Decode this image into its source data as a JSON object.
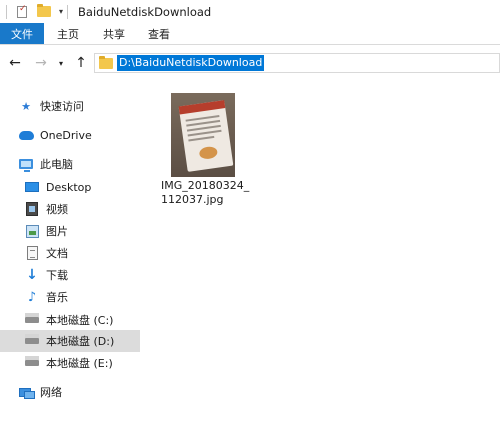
{
  "window": {
    "title": "BaiduNetdiskDownload"
  },
  "ribbon": {
    "tabs": [
      {
        "label": "文件"
      },
      {
        "label": "主页"
      },
      {
        "label": "共享"
      },
      {
        "label": "查看"
      }
    ]
  },
  "navigation": {
    "address": "D:\\BaiduNetdiskDownload"
  },
  "sidebar": {
    "items": [
      {
        "label": "快速访问",
        "icon": "star-icon"
      },
      {
        "label": "OneDrive",
        "icon": "cloud-icon"
      },
      {
        "label": "此电脑",
        "icon": "computer-icon"
      },
      {
        "label": "Desktop",
        "icon": "desktop-folder-icon"
      },
      {
        "label": "视频",
        "icon": "video-folder-icon"
      },
      {
        "label": "图片",
        "icon": "pictures-folder-icon"
      },
      {
        "label": "文档",
        "icon": "documents-folder-icon"
      },
      {
        "label": "下载",
        "icon": "download-icon"
      },
      {
        "label": "音乐",
        "icon": "music-icon"
      },
      {
        "label": "本地磁盘 (C:)",
        "icon": "drive-icon"
      },
      {
        "label": "本地磁盘 (D:)",
        "icon": "drive-icon",
        "selected": true
      },
      {
        "label": "本地磁盘 (E:)",
        "icon": "drive-icon"
      },
      {
        "label": "网络",
        "icon": "network-icon"
      }
    ]
  },
  "content": {
    "files": [
      {
        "name_line1": "IMG_20180324_",
        "name_line2": "112037.jpg",
        "type": "image-thumbnail"
      }
    ]
  },
  "colors": {
    "accent": "#1979ca",
    "selection_highlight": "#0078d7",
    "sidebar_selected": "#dcdcdc"
  }
}
